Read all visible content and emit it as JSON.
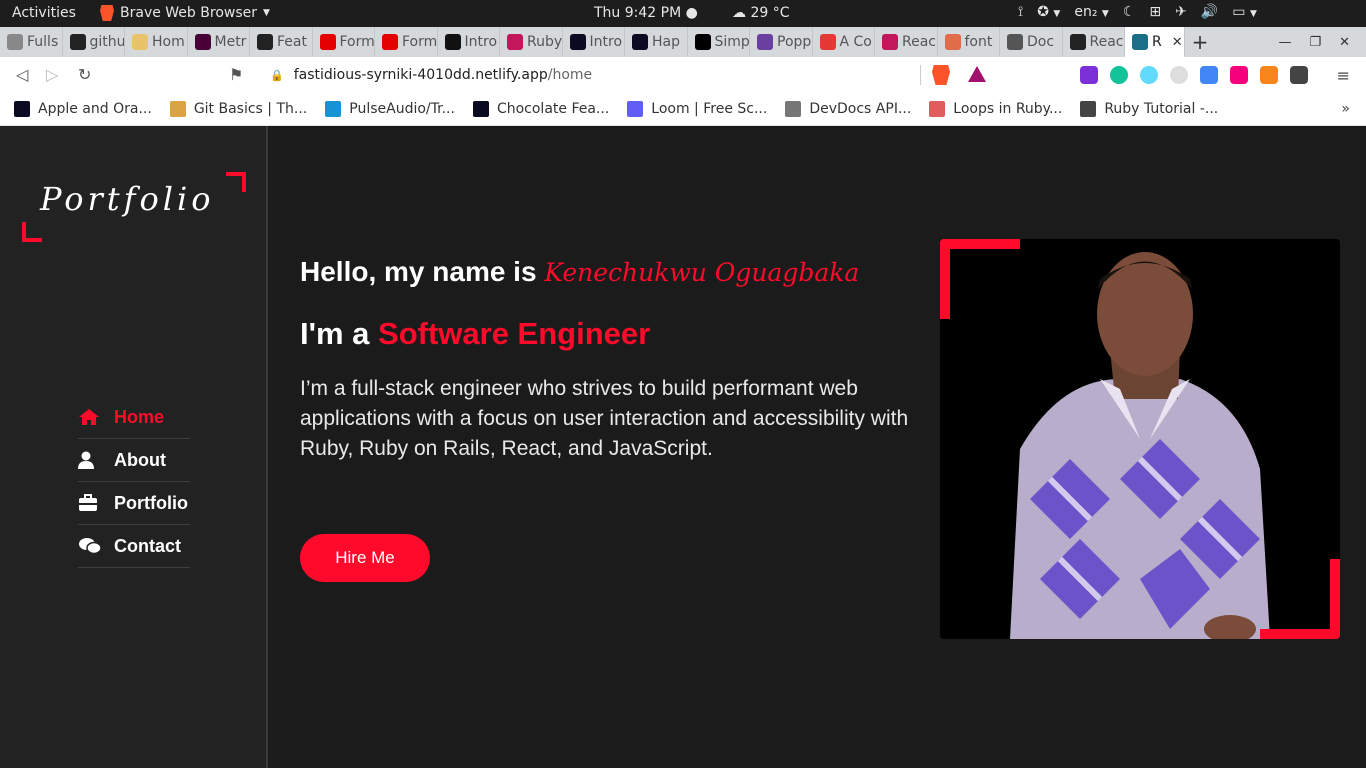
{
  "system_bar": {
    "activities": "Activities",
    "app_name": "Brave Web Browser",
    "clock": "Thu  9:42 PM",
    "weather": "29 °C",
    "language": "en₂"
  },
  "tabs": [
    {
      "label": "Fulls",
      "icon": "page-icon",
      "color": "#888888"
    },
    {
      "label": "githu",
      "icon": "github-icon",
      "color": "#222222"
    },
    {
      "label": "Hom",
      "icon": "site-icon",
      "color": "#e8c36a"
    },
    {
      "label": "Metr",
      "icon": "xd-icon",
      "color": "#470137"
    },
    {
      "label": "Feat",
      "icon": "github-icon",
      "color": "#222222"
    },
    {
      "label": "Form",
      "icon": "form-icon",
      "color": "#e40000"
    },
    {
      "label": "Form",
      "icon": "form-icon",
      "color": "#e40000"
    },
    {
      "label": "Intro",
      "icon": "m-icon",
      "color": "#111111"
    },
    {
      "label": "Ruby",
      "icon": "dn-icon",
      "color": "#c2185b"
    },
    {
      "label": "Intro",
      "icon": "hn-icon",
      "color": "#0a0a23"
    },
    {
      "label": "Hap",
      "icon": "hn-icon",
      "color": "#0a0a23"
    },
    {
      "label": "Simp",
      "icon": "medium-icon",
      "color": "#000000"
    },
    {
      "label": "Popp",
      "icon": "popper-icon",
      "color": "#6b3fa0"
    },
    {
      "label": "A Co",
      "icon": "star-icon",
      "color": "#e53935"
    },
    {
      "label": "Reac",
      "icon": "route-icon",
      "color": "#c2185b"
    },
    {
      "label": "font",
      "icon": "code-icon",
      "color": "#e06c4a"
    },
    {
      "label": "Doc",
      "icon": "globe-icon",
      "color": "#555555"
    },
    {
      "label": "Reac",
      "icon": "github-icon",
      "color": "#222222"
    },
    {
      "label": "R",
      "icon": "react-icon",
      "color": "#1b6f86",
      "active": true
    }
  ],
  "address_bar": {
    "domain": "fastidious-syrniki-4010dd.netlify.app",
    "path": "/home"
  },
  "bookmarks": [
    {
      "label": "Apple and Ora...",
      "icon": "hn-icon",
      "color": "#0a0a23"
    },
    {
      "label": "Git Basics | Th...",
      "icon": "odin-icon",
      "color": "#d9a441"
    },
    {
      "label": "PulseAudio/Tr...",
      "icon": "arch-icon",
      "color": "#1793d1"
    },
    {
      "label": "Chocolate Fea...",
      "icon": "hn-icon",
      "color": "#0a0a23"
    },
    {
      "label": "Loom | Free Sc...",
      "icon": "loom-icon",
      "color": "#625df5"
    },
    {
      "label": "DevDocs API...",
      "icon": "devdocs-icon",
      "color": "#777777"
    },
    {
      "label": "Loops in Ruby...",
      "icon": "stripes-icon",
      "color": "#e05d5d"
    },
    {
      "label": "Ruby Tutorial -...",
      "icon": "diamond-icon",
      "color": "#444444"
    }
  ],
  "sidebar": {
    "logo": "Portfolio",
    "nav": [
      {
        "label": "Home",
        "icon": "home-icon",
        "active": true
      },
      {
        "label": "About",
        "icon": "user-icon",
        "active": false
      },
      {
        "label": "Portfolio",
        "icon": "briefcase-icon",
        "active": false
      },
      {
        "label": "Contact",
        "icon": "chat-icon",
        "active": false
      }
    ]
  },
  "hero": {
    "greeting": "Hello, my name is",
    "name": "Kenechukwu Oguagbaka",
    "role_prefix": "I'm a",
    "role": "Software Engineer",
    "bio": "I’m a full-stack engineer who strives to build performant web applications with a focus on user interaction and accessibility with Ruby, Ruby on Rails, React, and JavaScript.",
    "cta": "Hire Me"
  },
  "colors": {
    "accent": "#ff0a2a",
    "sidebar_bg": "#222222",
    "page_bg": "#1b1b1c"
  }
}
